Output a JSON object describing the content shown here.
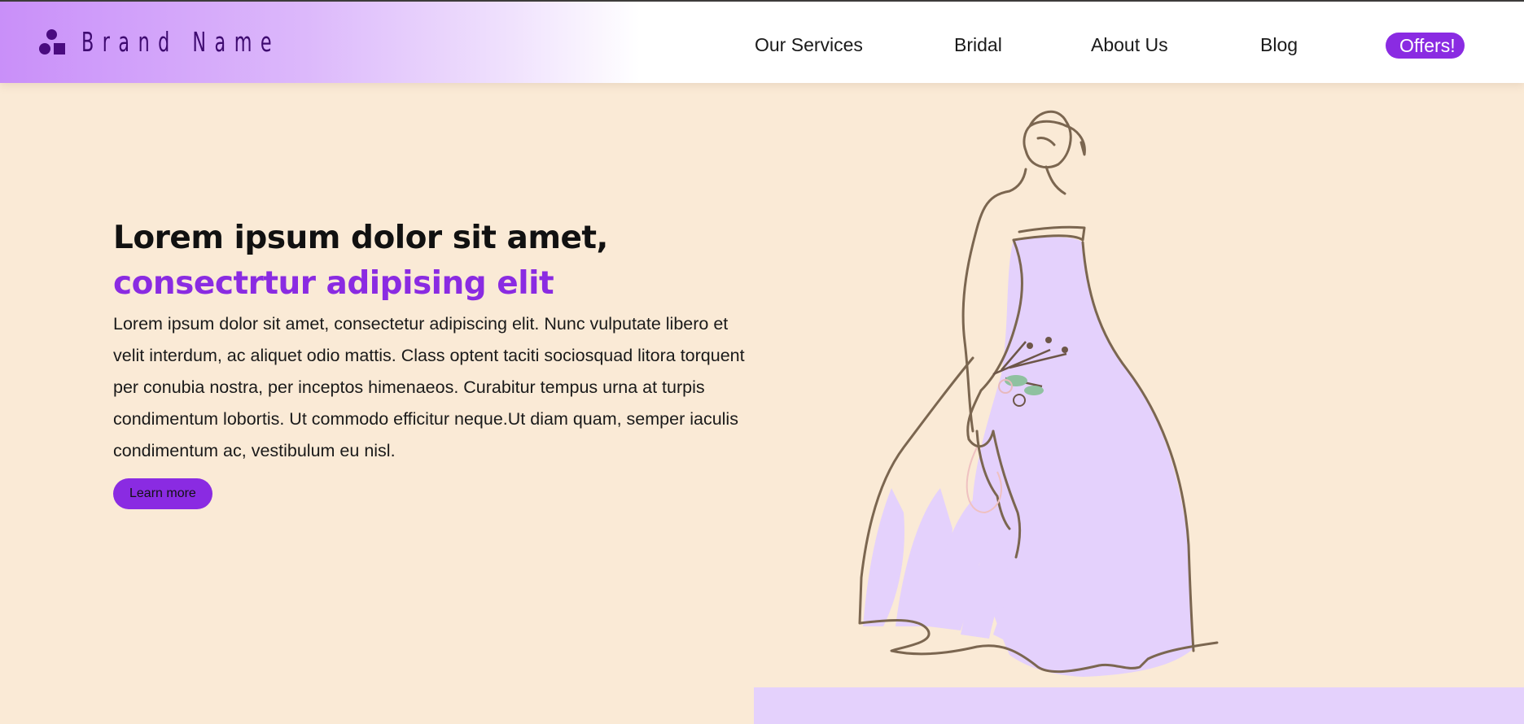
{
  "colors": {
    "accent": "#8a2be2",
    "brand_dark": "#4a0b80",
    "page_background": "#faead6",
    "dress_fill": "#e4d1fc",
    "sketch_line": "#7b6650"
  },
  "header": {
    "logo_icon": "shapes-logo-icon",
    "brand_name": "Brand Name"
  },
  "nav": {
    "items": [
      {
        "label": "Our Services"
      },
      {
        "label": "Bridal"
      },
      {
        "label": "About Us"
      },
      {
        "label": "Blog"
      }
    ],
    "offers_label": "Offers!"
  },
  "hero": {
    "title_line1": "Lorem ipsum dolor sit amet,",
    "title_line2": "consectrtur adipising elit",
    "body": "Lorem ipsum dolor sit amet, consectetur adipiscing elit. Nunc vulputate libero et velit interdum, ac aliquet odio mattis. Class optent taciti sociosquad litora torquent per conubia nostra, per inceptos himenaeos. Curabitur tempus urna at turpis condimentum lobortis. Ut commodo efficitur neque.Ut diam quam, semper iaculis condimentum ac, vestibulum eu nisl.",
    "cta_label": "Learn more",
    "illustration": "bride-sketch-illustration"
  }
}
